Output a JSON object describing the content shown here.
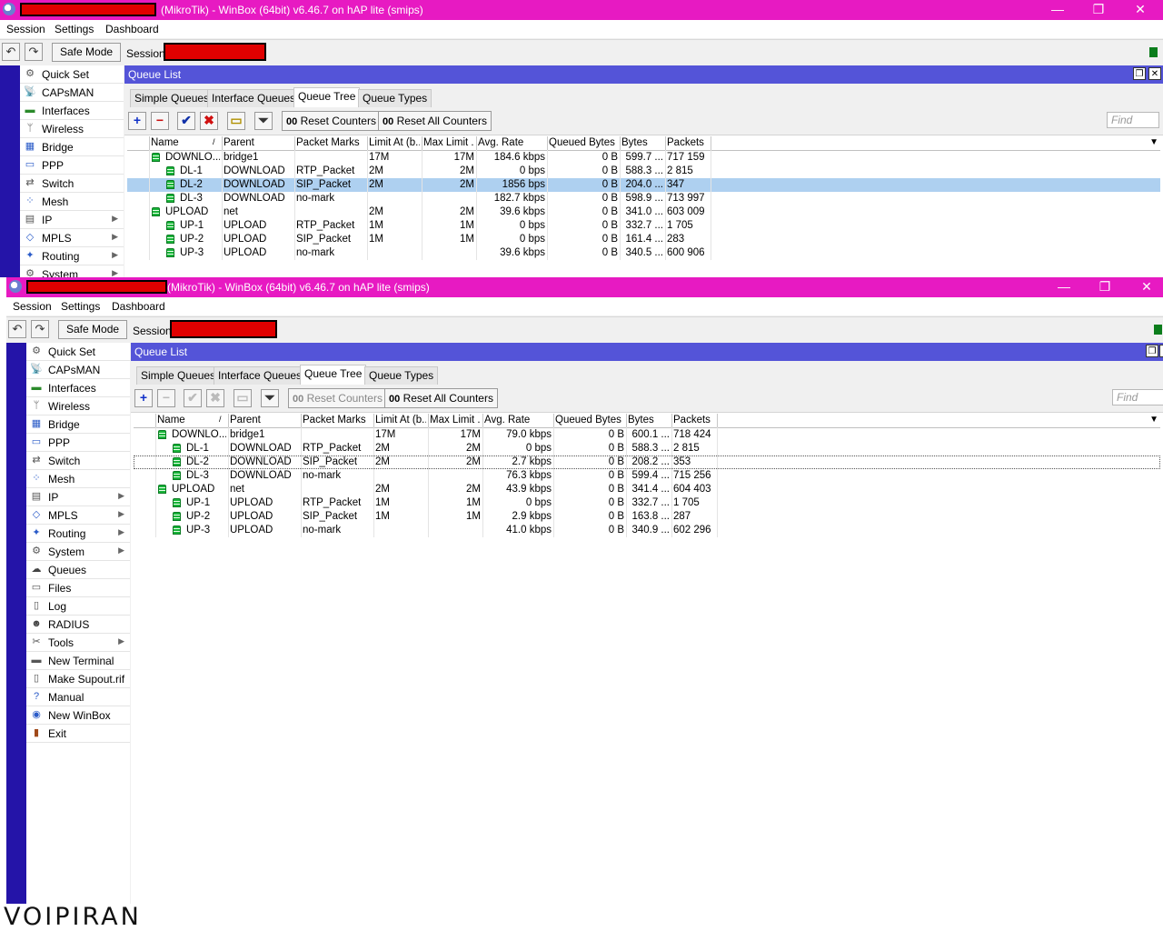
{
  "app": {
    "title": "(MikroTik) - WinBox (64bit) v6.46.7 on hAP lite (smips)",
    "menu": [
      "Session",
      "Settings",
      "Dashboard"
    ],
    "safe_mode_label": "Safe Mode",
    "session_label": "Session:"
  },
  "icons": {
    "undo": "undo-icon",
    "redo": "redo-icon",
    "minimize": "minimize-icon",
    "restore": "restore-icon",
    "close": "close-icon"
  },
  "sidebar": {
    "items": [
      {
        "label": "Quick Set",
        "icon": "quickset-icon",
        "glyph": "⚙",
        "arrow": false
      },
      {
        "label": "CAPsMAN",
        "icon": "capsman-icon",
        "glyph": "📡",
        "arrow": false
      },
      {
        "label": "Interfaces",
        "icon": "interfaces-icon",
        "glyph": "▬",
        "arrow": false
      },
      {
        "label": "Wireless",
        "icon": "wireless-icon",
        "glyph": "ᛘ",
        "arrow": false
      },
      {
        "label": "Bridge",
        "icon": "bridge-icon",
        "glyph": "▦",
        "arrow": false
      },
      {
        "label": "PPP",
        "icon": "ppp-icon",
        "glyph": "▭",
        "arrow": false
      },
      {
        "label": "Switch",
        "icon": "switch-icon",
        "glyph": "⇄",
        "arrow": false
      },
      {
        "label": "Mesh",
        "icon": "mesh-icon",
        "glyph": "⁘",
        "arrow": false
      },
      {
        "label": "IP",
        "icon": "ip-icon",
        "glyph": "▤",
        "arrow": true
      },
      {
        "label": "MPLS",
        "icon": "mpls-icon",
        "glyph": "◇",
        "arrow": true
      },
      {
        "label": "Routing",
        "icon": "routing-icon",
        "glyph": "✦",
        "arrow": true
      },
      {
        "label": "System",
        "icon": "system-icon",
        "glyph": "⚙",
        "arrow": true
      },
      {
        "label": "Queues",
        "icon": "queues-icon",
        "glyph": "☁",
        "arrow": false
      },
      {
        "label": "Files",
        "icon": "files-icon",
        "glyph": "▭",
        "arrow": false
      },
      {
        "label": "Log",
        "icon": "log-icon",
        "glyph": "▯",
        "arrow": false
      },
      {
        "label": "RADIUS",
        "icon": "radius-icon",
        "glyph": "☻",
        "arrow": false
      },
      {
        "label": "Tools",
        "icon": "tools-icon",
        "glyph": "✂",
        "arrow": true
      },
      {
        "label": "New Terminal",
        "icon": "terminal-icon",
        "glyph": "▬",
        "arrow": false
      },
      {
        "label": "Make Supout.rif",
        "icon": "supout-icon",
        "glyph": "▯",
        "arrow": false
      },
      {
        "label": "Manual",
        "icon": "manual-icon",
        "glyph": "?",
        "arrow": false
      },
      {
        "label": "New WinBox",
        "icon": "winbox-icon",
        "glyph": "◉",
        "arrow": false
      },
      {
        "label": "Exit",
        "icon": "exit-icon",
        "glyph": "▮",
        "arrow": false
      }
    ]
  },
  "queue_list": {
    "title": "Queue List",
    "tabs": [
      "Simple Queues",
      "Interface Queues",
      "Queue Tree",
      "Queue Types"
    ],
    "active_tab": 2,
    "reset_counters": "Reset Counters",
    "reset_all_counters": "Reset All Counters",
    "reset_prefix": "00",
    "find_placeholder": "Find",
    "columns": [
      "Name",
      "Parent",
      "Packet Marks",
      "Limit At (b...",
      "Max Limit ...",
      "Avg. Rate",
      "Queued Bytes",
      "Bytes",
      "Packets"
    ]
  },
  "window_top": {
    "rows": [
      {
        "name": "DOWNLO...",
        "level": 0,
        "parent": "bridge1",
        "marks": "",
        "limit_at": "17M",
        "max_limit": "17M",
        "avg_rate": "184.6 kbps",
        "queued": "0 B",
        "bytes": "599.7 ...",
        "packets": "717 159"
      },
      {
        "name": "DL-1",
        "level": 1,
        "parent": "DOWNLOAD",
        "marks": "RTP_Packet",
        "limit_at": "2M",
        "max_limit": "2M",
        "avg_rate": "0 bps",
        "queued": "0 B",
        "bytes": "588.3 ...",
        "packets": "2 815"
      },
      {
        "name": "DL-2",
        "level": 1,
        "parent": "DOWNLOAD",
        "marks": "SIP_Packet",
        "limit_at": "2M",
        "max_limit": "2M",
        "avg_rate": "1856 bps",
        "queued": "0 B",
        "bytes": "204.0 ...",
        "packets": "347"
      },
      {
        "name": "DL-3",
        "level": 1,
        "parent": "DOWNLOAD",
        "marks": "no-mark",
        "limit_at": "",
        "max_limit": "",
        "avg_rate": "182.7 kbps",
        "queued": "0 B",
        "bytes": "598.9 ...",
        "packets": "713 997"
      },
      {
        "name": "UPLOAD",
        "level": 0,
        "parent": "net",
        "marks": "",
        "limit_at": "2M",
        "max_limit": "2M",
        "avg_rate": "39.6 kbps",
        "queued": "0 B",
        "bytes": "341.0 ...",
        "packets": "603 009"
      },
      {
        "name": "UP-1",
        "level": 1,
        "parent": "UPLOAD",
        "marks": "RTP_Packet",
        "limit_at": "1M",
        "max_limit": "1M",
        "avg_rate": "0 bps",
        "queued": "0 B",
        "bytes": "332.7 ...",
        "packets": "1 705"
      },
      {
        "name": "UP-2",
        "level": 1,
        "parent": "UPLOAD",
        "marks": "SIP_Packet",
        "limit_at": "1M",
        "max_limit": "1M",
        "avg_rate": "0 bps",
        "queued": "0 B",
        "bytes": "161.4 ...",
        "packets": "283"
      },
      {
        "name": "UP-3",
        "level": 1,
        "parent": "UPLOAD",
        "marks": "no-mark",
        "limit_at": "",
        "max_limit": "",
        "avg_rate": "39.6 kbps",
        "queued": "0 B",
        "bytes": "340.5 ...",
        "packets": "600 906"
      }
    ]
  },
  "window_bottom": {
    "rows": [
      {
        "name": "DOWNLO...",
        "level": 0,
        "parent": "bridge1",
        "marks": "",
        "limit_at": "17M",
        "max_limit": "17M",
        "avg_rate": "79.0 kbps",
        "queued": "0 B",
        "bytes": "600.1 ...",
        "packets": "718 424"
      },
      {
        "name": "DL-1",
        "level": 1,
        "parent": "DOWNLOAD",
        "marks": "RTP_Packet",
        "limit_at": "2M",
        "max_limit": "2M",
        "avg_rate": "0 bps",
        "queued": "0 B",
        "bytes": "588.3 ...",
        "packets": "2 815"
      },
      {
        "name": "DL-2",
        "level": 1,
        "parent": "DOWNLOAD",
        "marks": "SIP_Packet",
        "limit_at": "2M",
        "max_limit": "2M",
        "avg_rate": "2.7 kbps",
        "queued": "0 B",
        "bytes": "208.2 ...",
        "packets": "353"
      },
      {
        "name": "DL-3",
        "level": 1,
        "parent": "DOWNLOAD",
        "marks": "no-mark",
        "limit_at": "",
        "max_limit": "",
        "avg_rate": "76.3 kbps",
        "queued": "0 B",
        "bytes": "599.4 ...",
        "packets": "715 256"
      },
      {
        "name": "UPLOAD",
        "level": 0,
        "parent": "net",
        "marks": "",
        "limit_at": "2M",
        "max_limit": "2M",
        "avg_rate": "43.9 kbps",
        "queued": "0 B",
        "bytes": "341.4 ...",
        "packets": "604 403"
      },
      {
        "name": "UP-1",
        "level": 1,
        "parent": "UPLOAD",
        "marks": "RTP_Packet",
        "limit_at": "1M",
        "max_limit": "1M",
        "avg_rate": "0 bps",
        "queued": "0 B",
        "bytes": "332.7 ...",
        "packets": "1 705"
      },
      {
        "name": "UP-2",
        "level": 1,
        "parent": "UPLOAD",
        "marks": "SIP_Packet",
        "limit_at": "1M",
        "max_limit": "1M",
        "avg_rate": "2.9 kbps",
        "queued": "0 B",
        "bytes": "163.8 ...",
        "packets": "287"
      },
      {
        "name": "UP-3",
        "level": 1,
        "parent": "UPLOAD",
        "marks": "no-mark",
        "limit_at": "",
        "max_limit": "",
        "avg_rate": "41.0 kbps",
        "queued": "0 B",
        "bytes": "340.9 ...",
        "packets": "602 296"
      }
    ]
  },
  "watermark": "VOIPIRAN",
  "colors": {
    "titlebar": "#e71ac2",
    "queue_title": "#5454d8",
    "side_strip": "#2414a8",
    "selected_row": "#aed0f0",
    "queue_icon": "#19b43a"
  }
}
